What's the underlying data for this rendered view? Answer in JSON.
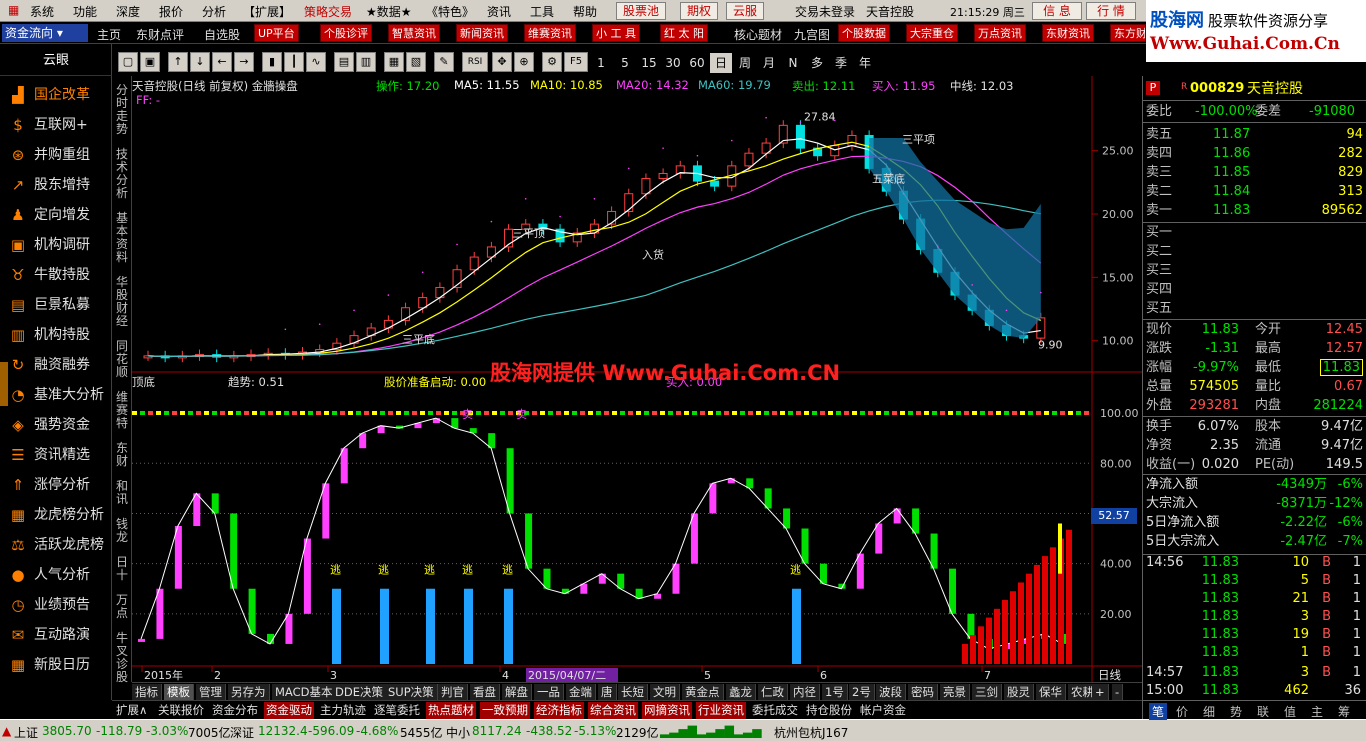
{
  "menubar": {
    "items": [
      "系统",
      "功能",
      "深度",
      "报价",
      "分析",
      "【扩展】",
      "策略交易",
      "★数据★",
      "《特色》",
      "资讯",
      "工具",
      "帮助"
    ],
    "buttons": [
      "股票池",
      "期权",
      "云服"
    ],
    "login": "交易未登录",
    "app_title": "天音控股",
    "clock": "21:15:29 周三",
    "xinxi": "信 息",
    "hangqing": "行 情",
    "jiaoyi": "交 易",
    "brand_name": "股海网",
    "brand_tag": "股票软件资源分享",
    "brand_url": "Www.Guhai.Com.Cn"
  },
  "navbar": {
    "selector": "资金流向",
    "items": [
      "主页",
      "东财点评",
      "自选股"
    ],
    "buttons": [
      "UP平台",
      "个股诊评",
      "智慧资讯",
      "新闻资讯",
      "维赛资讯",
      "小 工 具",
      "红 太 阳"
    ],
    "items2": [
      "核心题材",
      "九宫图"
    ],
    "buttons2": [
      "个股数据",
      "大宗重仓",
      "万点资讯",
      "东财资讯",
      "东方财"
    ]
  },
  "sidebar": {
    "title": "云眼",
    "items": [
      "国企改革",
      "互联网+",
      "并购重组",
      "股东增持",
      "定向增发",
      "机构调研",
      "牛散持股",
      "巨景私募",
      "机构持股",
      "融资融券",
      "基准大分析",
      "强势资金",
      "资讯精选",
      "涨停分析",
      "龙虎榜分析",
      "活跃龙虎榜",
      "人气分析",
      "业绩预告",
      "互动路演",
      "新股日历"
    ],
    "icons": [
      "chart-up-icon",
      "coin-icon",
      "merge-icon",
      "line-up-icon",
      "person-icon",
      "bank-icon",
      "bull-icon",
      "bag-icon",
      "building-icon",
      "cycle-icon",
      "analysis-icon",
      "fund-icon",
      "news-icon",
      "rise-icon",
      "dragon-icon",
      "balance-icon",
      "piggy-icon",
      "forecast-icon",
      "chat-icon",
      "calendar-icon"
    ]
  },
  "toolbar": {
    "periods": [
      "1",
      "5",
      "15",
      "30",
      "60",
      "日",
      "周",
      "月",
      "N",
      "多",
      "季",
      "年"
    ],
    "selected_period": "日",
    "tools": [
      "F5",
      "RSI"
    ]
  },
  "vtabs": [
    "分时走势",
    "技术分析",
    "基本资料",
    "华股财经",
    "同花顺",
    "维赛特",
    "东财",
    "和讯",
    "钱龙",
    "日十",
    "万点",
    "牛叉诊股"
  ],
  "chart": {
    "title": "天音控股(日线 前复权) 金牆操盘",
    "cao_zuo": "操作: 17.20",
    "ma5": "MA5: 11.55",
    "ma10": "MA10: 10.85",
    "ma20": "MA20: 14.32",
    "ma60": "MA60: 19.79",
    "mai_chu": "卖出: 12.11",
    "mai_ru": "买入: 11.95",
    "zhong_xian": "中线: 12.03",
    "ff": "FF: -",
    "price_axis": [
      "25.00",
      "20.00",
      "15.00",
      "10.00"
    ],
    "high_label": "27.84",
    "low_label": "9.90",
    "annotations": [
      "三平顶",
      "三平底",
      "入货",
      "五菜底",
      "三平项"
    ],
    "lower_title": "顶底",
    "trend": "趋势: 0.51",
    "ready": "股价准备启动: 0.00",
    "buy_point": "买入: 0.00",
    "lower_axis": [
      "100.00",
      "80.00",
      "60.00",
      "40.00",
      "20.00"
    ],
    "cursor_value": "52.57",
    "sell_label": "卖",
    "escape_label": "逃",
    "watermark": "股海网提供 Www.Guhai.Com.CN"
  },
  "chart_data": {
    "type": "candlestick",
    "title": "天音控股(日线 前复权)",
    "x_labels": [
      "2015年",
      "2",
      "3",
      "4",
      "2015/04/07/二",
      "5",
      "6",
      "7"
    ],
    "ylim": [
      8,
      29
    ],
    "close_series": [
      8.8,
      8.7,
      8.8,
      8.9,
      8.7,
      8.8,
      8.9,
      9.0,
      8.9,
      9.1,
      9.3,
      9.8,
      10.4,
      11.0,
      11.6,
      12.6,
      13.4,
      14.2,
      15.6,
      16.6,
      17.4,
      18.8,
      19.2,
      18.8,
      17.8,
      18.5,
      19.2,
      20.2,
      21.6,
      22.8,
      23.2,
      23.8,
      22.6,
      22.2,
      23.8,
      24.8,
      25.6,
      27.0,
      25.2,
      24.6,
      25.4,
      26.2,
      23.6,
      21.8,
      19.6,
      17.2,
      15.4,
      13.6,
      12.4,
      11.2,
      10.4,
      10.2,
      11.8
    ],
    "series": [
      {
        "name": "MA5"
      },
      {
        "name": "MA10"
      },
      {
        "name": "MA20"
      },
      {
        "name": "MA60"
      }
    ],
    "lower_ylim": [
      0,
      110
    ]
  },
  "bottom_tabs": [
    "指标",
    "模板",
    "管理",
    "另存为",
    "MACD基本",
    "DDE决策",
    "SUP决策",
    "判官",
    "看盘",
    "解盘",
    "一品",
    "金端",
    "唐",
    "长短",
    "文明",
    "黄金点",
    "蠡龙",
    "仁政",
    "内径",
    "1号",
    "2号",
    "波段",
    "密码",
    "亮景",
    "三剑",
    "股灵",
    "保华",
    "农耕"
  ],
  "bottom_tab_selected": "模板",
  "bottom_tabs2": [
    "扩展∧",
    "关联报价",
    "资金分布",
    "资金驱动",
    "主力轨迹",
    "逐笔委托",
    "热点题材",
    "一致预期",
    "经济指标",
    "综合资讯",
    "网摘资讯",
    "行业资讯",
    "委托成交",
    "持仓股份",
    "帐户资金"
  ],
  "bottom_tabs2_hl": [
    "资金驱动",
    "热点题材",
    "一致预期",
    "经济指标",
    "综合资讯",
    "网摘资讯",
    "行业资讯"
  ],
  "x_unit": "日线",
  "status": {
    "sh": "上证",
    "sh_val": "3805.70",
    "sh_chg": "-118.79",
    "sh_pct": "-3.03%",
    "sh_amt": "7005亿",
    "sz": "深证",
    "sz_val": "12132.4",
    "sz_chg": "-596.09",
    "sz_pct": "-4.68%",
    "sz_amt": "5455亿",
    "zx": "中小",
    "zx_val": "8117.24",
    "zx_chg": "-438.52",
    "zx_pct": "-5.13%",
    "zx_amt": "2129亿",
    "server": "杭州包杭J167"
  },
  "quote": {
    "code": "000829",
    "name": "天音控股",
    "wei_bi_label": "委比",
    "wei_bi": "-100.00%",
    "wei_cha_label": "委差",
    "wei_cha": "-91080",
    "asks": [
      {
        "label": "卖五",
        "price": "11.87",
        "vol": "94"
      },
      {
        "label": "卖四",
        "price": "11.86",
        "vol": "282"
      },
      {
        "label": "卖三",
        "price": "11.85",
        "vol": "829"
      },
      {
        "label": "卖二",
        "price": "11.84",
        "vol": "313"
      },
      {
        "label": "卖一",
        "price": "11.83",
        "vol": "89562"
      }
    ],
    "bids": [
      "买一",
      "买二",
      "买三",
      "买四",
      "买五"
    ],
    "stats": [
      {
        "l1": "现价",
        "v1": "11.83",
        "l2": "今开",
        "v2": "12.45"
      },
      {
        "l1": "涨跌",
        "v1": "-1.31",
        "l2": "最高",
        "v2": "12.57"
      },
      {
        "l1": "涨幅",
        "v1": "-9.97%",
        "l2": "最低",
        "v2": "11.83"
      },
      {
        "l1": "总量",
        "v1": "574505",
        "l2": "量比",
        "v2": "0.67"
      },
      {
        "l1": "外盘",
        "v1": "293281",
        "l2": "内盘",
        "v2": "281224"
      }
    ],
    "stats2": [
      {
        "l1": "换手",
        "v1": "6.07%",
        "l2": "股本",
        "v2": "9.47亿"
      },
      {
        "l1": "净资",
        "v1": "2.35",
        "l2": "流通",
        "v2": "9.47亿"
      },
      {
        "l1": "收益(一)",
        "v1": "0.020",
        "l2": "PE(动)",
        "v2": "149.5"
      }
    ],
    "flows": [
      {
        "label": "净流入额",
        "val": "-4349万",
        "pct": "-6%"
      },
      {
        "label": "大宗流入",
        "val": "-8371万",
        "pct": "-12%"
      },
      {
        "label": "5日净流入额",
        "val": "-2.22亿",
        "pct": "-6%"
      },
      {
        "label": "5日大宗流入",
        "val": "-2.47亿",
        "pct": "-7%"
      }
    ],
    "ticks": [
      {
        "time": "14:56",
        "price": "11.83",
        "vol": "10",
        "bs": "B",
        "n": "1"
      },
      {
        "time": "",
        "price": "11.83",
        "vol": "5",
        "bs": "B",
        "n": "1"
      },
      {
        "time": "",
        "price": "11.83",
        "vol": "21",
        "bs": "B",
        "n": "1"
      },
      {
        "time": "",
        "price": "11.83",
        "vol": "3",
        "bs": "B",
        "n": "1"
      },
      {
        "time": "",
        "price": "11.83",
        "vol": "19",
        "bs": "B",
        "n": "1"
      },
      {
        "time": "",
        "price": "11.83",
        "vol": "1",
        "bs": "B",
        "n": "1"
      },
      {
        "time": "14:57",
        "price": "11.83",
        "vol": "3",
        "bs": "B",
        "n": "1"
      },
      {
        "time": "15:00",
        "price": "11.83",
        "vol": "462",
        "bs": "",
        "n": "36"
      }
    ],
    "tabs": [
      "笔",
      "价",
      "细",
      "势",
      "联",
      "值",
      "主",
      "筹"
    ]
  }
}
